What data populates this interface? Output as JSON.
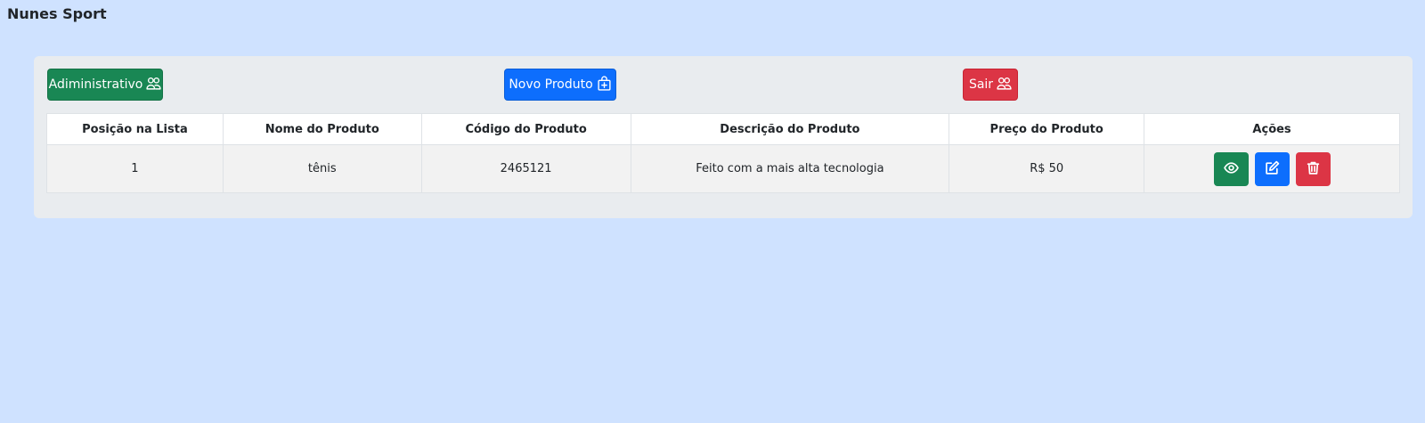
{
  "brand": "Nunes Sport",
  "toolbar": {
    "admin_label": "Adiministrativo",
    "novo_label": "Novo Produto",
    "sair_label": "Sair"
  },
  "colors": {
    "background": "#cfe2ff",
    "panel": "#e9ecef",
    "success": "#198754",
    "primary": "#0d6efd",
    "danger": "#dc3545"
  },
  "table": {
    "headers": [
      "Posição na Lista",
      "Nome do Produto",
      "Código do Produto",
      "Descrição do Produto",
      "Preço do Produto",
      "Ações"
    ],
    "rows": [
      {
        "posicao": "1",
        "nome": "tênis",
        "codigo": "2465121",
        "descricao": "Feito com a mais alta tecnologia",
        "preco": "R$ 50",
        "actions": [
          "eye-icon",
          "edit-icon",
          "trash-icon"
        ]
      }
    ]
  }
}
